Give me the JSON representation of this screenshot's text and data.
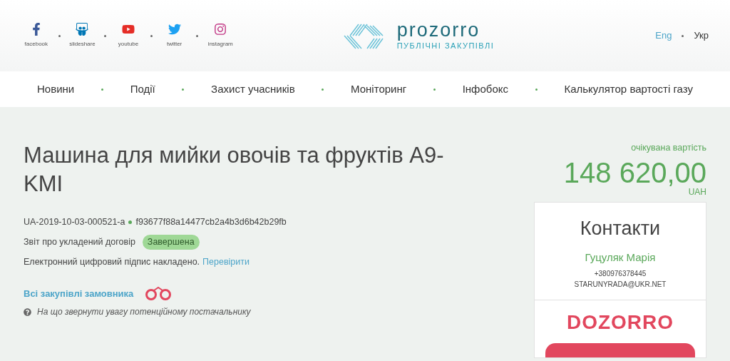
{
  "social": [
    {
      "kind": "facebook",
      "label": "facebook"
    },
    {
      "kind": "slideshare",
      "label": "slideshare"
    },
    {
      "kind": "youtube",
      "label": "youtube"
    },
    {
      "kind": "twitter",
      "label": "twitter"
    },
    {
      "kind": "instagram",
      "label": "instagram"
    }
  ],
  "logo": {
    "name": "prozorro",
    "subtitle": "ПУБЛІЧНІ ЗАКУПІВЛІ"
  },
  "languages": [
    {
      "label": "Eng",
      "selected": false
    },
    {
      "label": "Укр",
      "selected": true
    }
  ],
  "nav": [
    "Новини",
    "Події",
    "Захист учасників",
    "Моніторинг",
    "Інфобокс",
    "Калькулятор вартості газу"
  ],
  "tender": {
    "title": "Машина для мийки овочів та фруктів A9-KMI",
    "id": "UA-2019-10-03-000521-a",
    "hash": "f93677f88a14477cb2a4b3d6b42b29fb",
    "type": "Звіт про укладений договір",
    "status": "Завершена",
    "signature": "Електронний цифровий підпис накладено.",
    "verify_link": "Перевірити",
    "all_link": "Всі закупівлі замовника",
    "hint": "На що звернути увагу потенційному постачальнику"
  },
  "price": {
    "label": "очікувана вартість",
    "amount": "148 620,00",
    "currency": "UAH"
  },
  "contacts": {
    "title": "Контакти",
    "name": "Гуцуляк Марія",
    "phone": "+380976378445",
    "email": "STARUNYRADA@UKR.NET"
  },
  "dozorro": {
    "logo": "DOZORRO"
  }
}
